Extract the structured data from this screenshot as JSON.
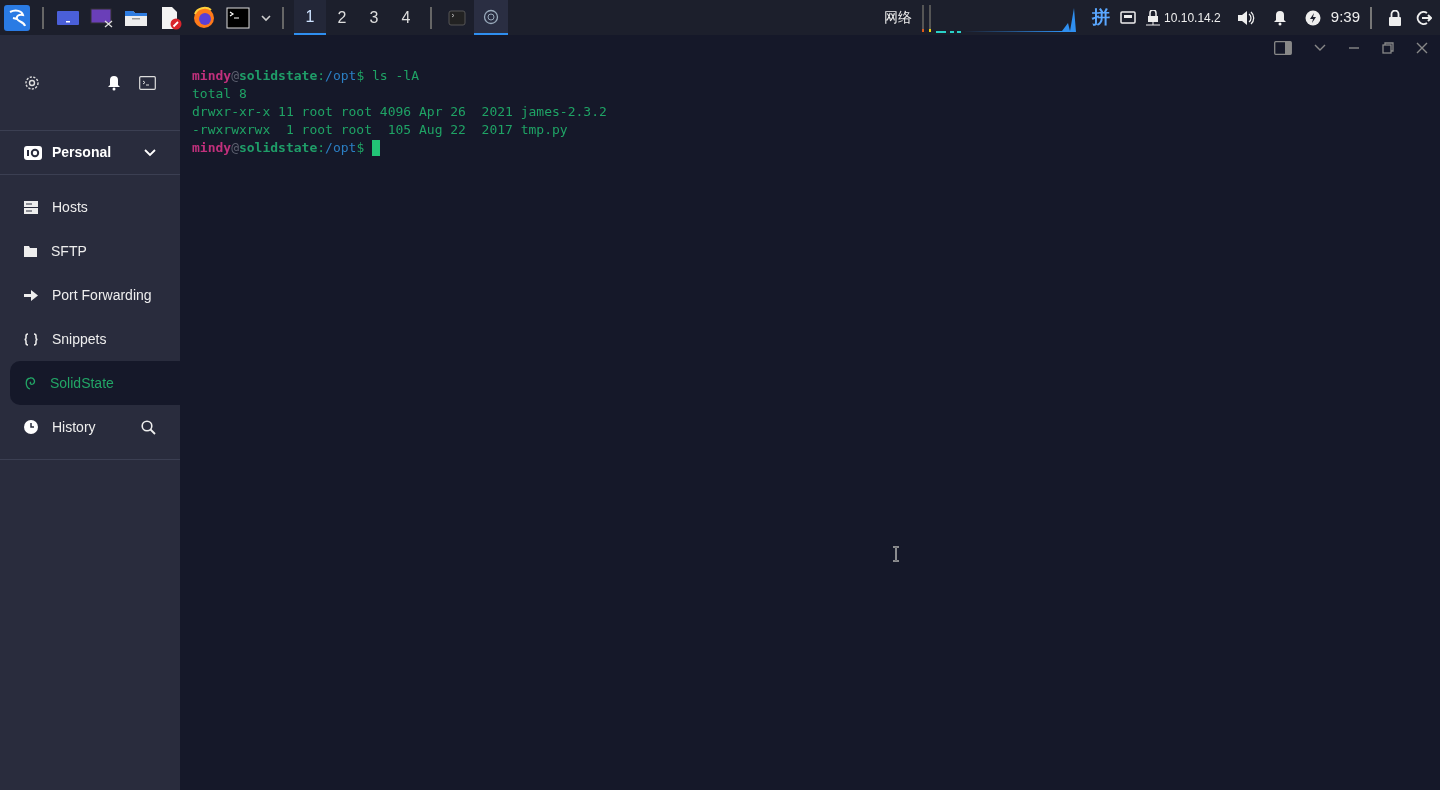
{
  "taskbar": {
    "launchers": [
      {
        "kind": "menu"
      },
      {
        "kind": "desktop"
      },
      {
        "kind": "screen"
      },
      {
        "kind": "folder"
      },
      {
        "kind": "editor"
      },
      {
        "kind": "browser"
      },
      {
        "kind": "terminal"
      },
      {
        "kind": "caret"
      }
    ],
    "workspaces": [
      {
        "label": "1",
        "selected": true
      },
      {
        "label": "2",
        "selected": false
      },
      {
        "label": "3",
        "selected": false
      },
      {
        "label": "4",
        "selected": false
      }
    ],
    "tasks": [
      {
        "kind": "terminal",
        "selected": false
      },
      {
        "kind": "app",
        "selected": true
      }
    ],
    "network_label": "网络",
    "input_method": "拼",
    "ip": "10.10.14.2",
    "time": "9:39"
  },
  "sidebar": {
    "section": "Personal",
    "items": [
      {
        "kind": "hosts",
        "label": "Hosts",
        "selected": false
      },
      {
        "kind": "sftp",
        "label": "SFTP",
        "selected": false
      },
      {
        "kind": "forward",
        "label": "Port Forwarding",
        "selected": false
      },
      {
        "kind": "snippets",
        "label": "Snippets",
        "selected": false
      },
      {
        "kind": "session",
        "label": "SolidState",
        "selected": true
      },
      {
        "kind": "history",
        "label": "History",
        "selected": false
      }
    ]
  },
  "terminal": {
    "lines": [
      [
        {
          "kind": "user",
          "text": "mindy"
        },
        {
          "kind": "at",
          "text": "@"
        },
        {
          "kind": "host",
          "text": "solidstate"
        },
        {
          "kind": "colon",
          "text": ":"
        },
        {
          "kind": "path",
          "text": "/opt"
        },
        {
          "kind": "plain",
          "text": "$ ls -lA"
        }
      ],
      [
        {
          "kind": "output",
          "text": "total 8"
        }
      ],
      [
        {
          "kind": "output",
          "text": "drwxr-xr-x 11 root root 4096 Apr 26  2021 james-2.3.2"
        }
      ],
      [
        {
          "kind": "output",
          "text": "-rwxrwxrwx  1 root root  105 Aug 22  2017 tmp.py"
        }
      ],
      [
        {
          "kind": "user",
          "text": "mindy"
        },
        {
          "kind": "at",
          "text": "@"
        },
        {
          "kind": "host",
          "text": "solidstate"
        },
        {
          "kind": "colon",
          "text": ":"
        },
        {
          "kind": "path",
          "text": "/opt"
        },
        {
          "kind": "plain",
          "text": "$ "
        }
      ]
    ],
    "cursor": true
  }
}
